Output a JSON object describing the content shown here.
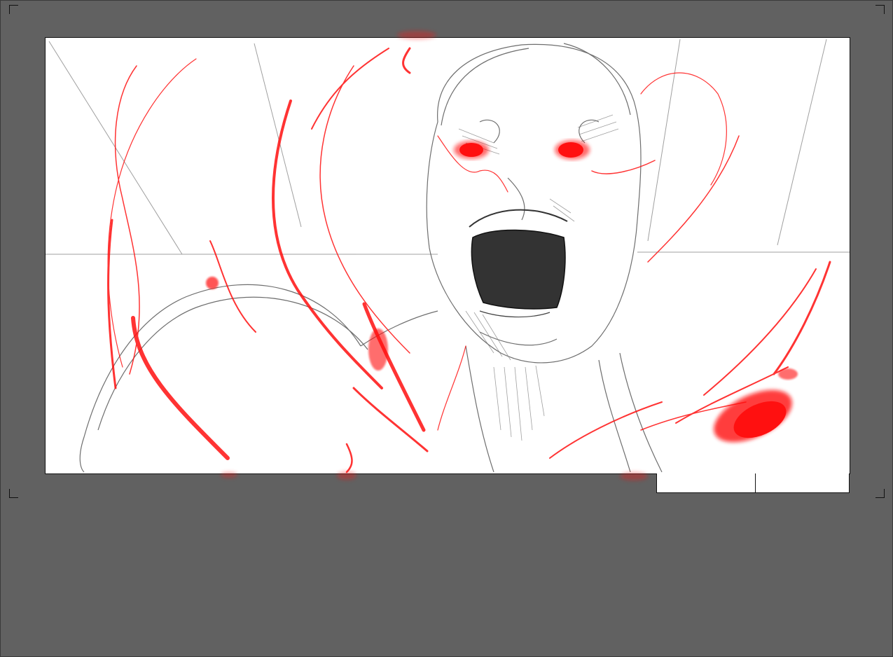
{
  "colors": {
    "background": "#616161",
    "panel": "#ffffff",
    "frame_line": "#111111",
    "pencil": "#555555",
    "red_pencil": "#ff1010",
    "mouth": "#333333"
  },
  "storyboard": {
    "panel_illustration": "screaming-figure-sketch",
    "slate": {
      "cell_1": "",
      "cell_2": ""
    }
  }
}
